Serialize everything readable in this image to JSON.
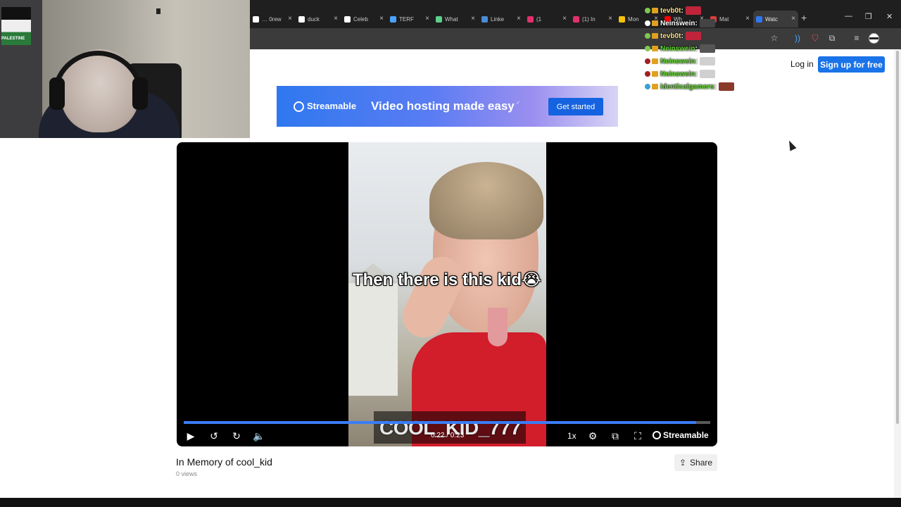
{
  "browser": {
    "tabs": [
      {
        "label": "… 0rew",
        "icon": "x-icon",
        "color": "#ffffff"
      },
      {
        "label": "duck",
        "icon": "tiktok-icon",
        "color": "#ffffff"
      },
      {
        "label": "Celeb",
        "icon": "tiktok-icon",
        "color": "#ffffff"
      },
      {
        "label": "TERF",
        "icon": "steam-icon",
        "color": "#4aa3ff"
      },
      {
        "label": "What",
        "icon": "chat-icon",
        "color": "#5bd18a"
      },
      {
        "label": "Linke",
        "icon": "link-icon",
        "color": "#4a8bd6"
      },
      {
        "label": "(1",
        "icon": "instagram-icon",
        "color": "#e1306c"
      },
      {
        "label": "(1) In",
        "icon": "instagram-icon",
        "color": "#e1306c"
      },
      {
        "label": "Mon",
        "icon": "arrow-icon",
        "color": "#f4c20d"
      },
      {
        "label": "Wh",
        "icon": "youtube-icon",
        "color": "#ff0000"
      },
      {
        "label": "Mat",
        "icon": "ad-icon",
        "color": "#e03c3c"
      },
      {
        "label": "Watc",
        "icon": "streamable-icon",
        "color": "#2f78ef",
        "active": true
      }
    ],
    "new_tab": "+",
    "win_min": "—",
    "win_max": "❐",
    "win_close": "✕"
  },
  "chat": [
    {
      "user": "tevb0t",
      "color": "#ffe08a",
      "badge": "#7ec850",
      "emote": "#c0243a"
    },
    {
      "user": "Neinswein",
      "color": "#ffffff",
      "badge": "#ffffff",
      "emote": "#444444"
    },
    {
      "user": "tevb0t",
      "color": "#ffe08a",
      "badge": "#7ec850",
      "emote": "#c0243a"
    },
    {
      "user": "Neinswein",
      "color": "#66dd33",
      "badge": "#7ec850",
      "emote": "#555555"
    },
    {
      "user": "Neinswein",
      "color": "#66dd33",
      "badge": "#a02020",
      "emote": "#d0d0d0"
    },
    {
      "user": "Neinswein",
      "color": "#66dd33",
      "badge": "#a02020",
      "emote": "#d0d0d0"
    },
    {
      "user": "identicalgamers",
      "color": "#66dd33",
      "badge": "#3aa0d0",
      "emote": "#8a3a2a"
    }
  ],
  "header": {
    "login": "Log in",
    "signup": "Sign up for free"
  },
  "banner": {
    "logo": "Streamable",
    "tagline": "Video hosting made easy",
    "cta": "Get started"
  },
  "player": {
    "caption": "Then there is this kid😭",
    "watermark": "COOL_KID_777",
    "time": "0:22 / 0:23",
    "progress": 0.973,
    "speed": "1x",
    "brand": "Streamable"
  },
  "video": {
    "title": "In Memory of cool_kid",
    "views": "0 views",
    "share": "Share"
  },
  "webcam": {
    "flag_text": "PALESTINE"
  }
}
